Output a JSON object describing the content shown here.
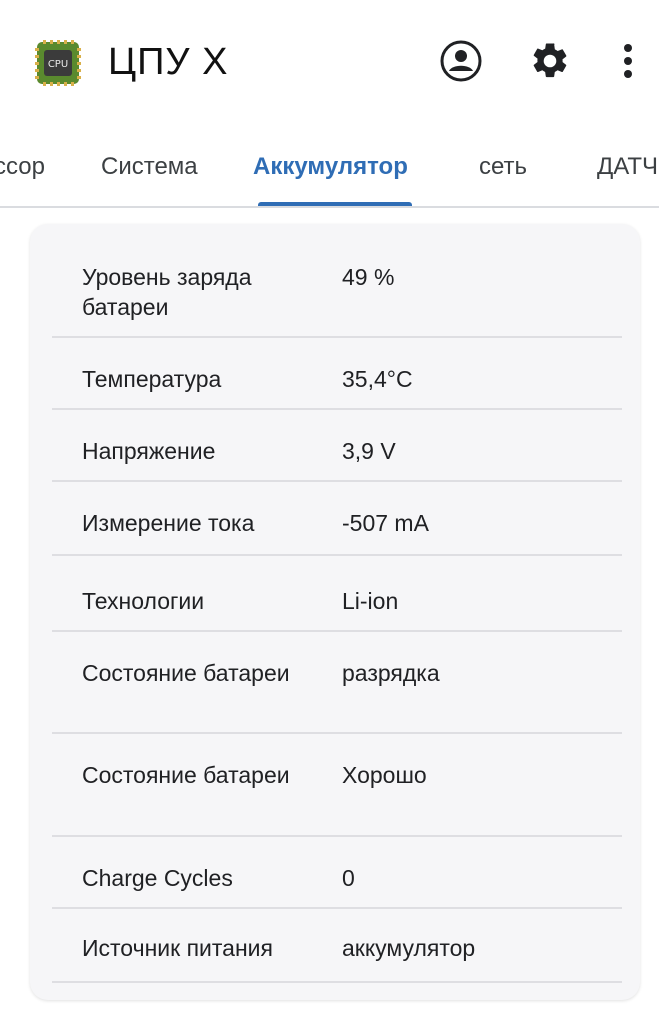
{
  "app": {
    "title": "ЦПУ X",
    "icon": "cpu-chip-icon",
    "icon_label": "CPU"
  },
  "actions": {
    "account_icon": "account-circle-icon",
    "settings_icon": "gear-icon",
    "more_icon": "more-vertical-icon"
  },
  "tabs": [
    {
      "label": "ссор",
      "active": false
    },
    {
      "label": "Система",
      "active": false
    },
    {
      "label": "Аккумулятор",
      "active": true
    },
    {
      "label": "сеть",
      "active": false
    },
    {
      "label": "ДАТЧ",
      "active": false
    }
  ],
  "battery": {
    "rows": [
      {
        "label": "Уровень заряда батареи",
        "value": "49 %"
      },
      {
        "label": "Температура",
        "value": "35,4°C"
      },
      {
        "label": "Напряжение",
        "value": "3,9 V"
      },
      {
        "label": "Измерение тока",
        "value": "-507 mA"
      },
      {
        "label": "Технологии",
        "value": "Li-ion"
      },
      {
        "label": "Состояние батареи",
        "value": "разрядка"
      },
      {
        "label": "Состояние батареи",
        "value": "Хорошо"
      },
      {
        "label": "Charge Cycles",
        "value": "0"
      },
      {
        "label": "Источник питания",
        "value": "аккумулятор"
      }
    ]
  },
  "colors": {
    "accent": "#2f6db5",
    "card_bg": "#f6f6f8",
    "divider": "#dedee2"
  }
}
